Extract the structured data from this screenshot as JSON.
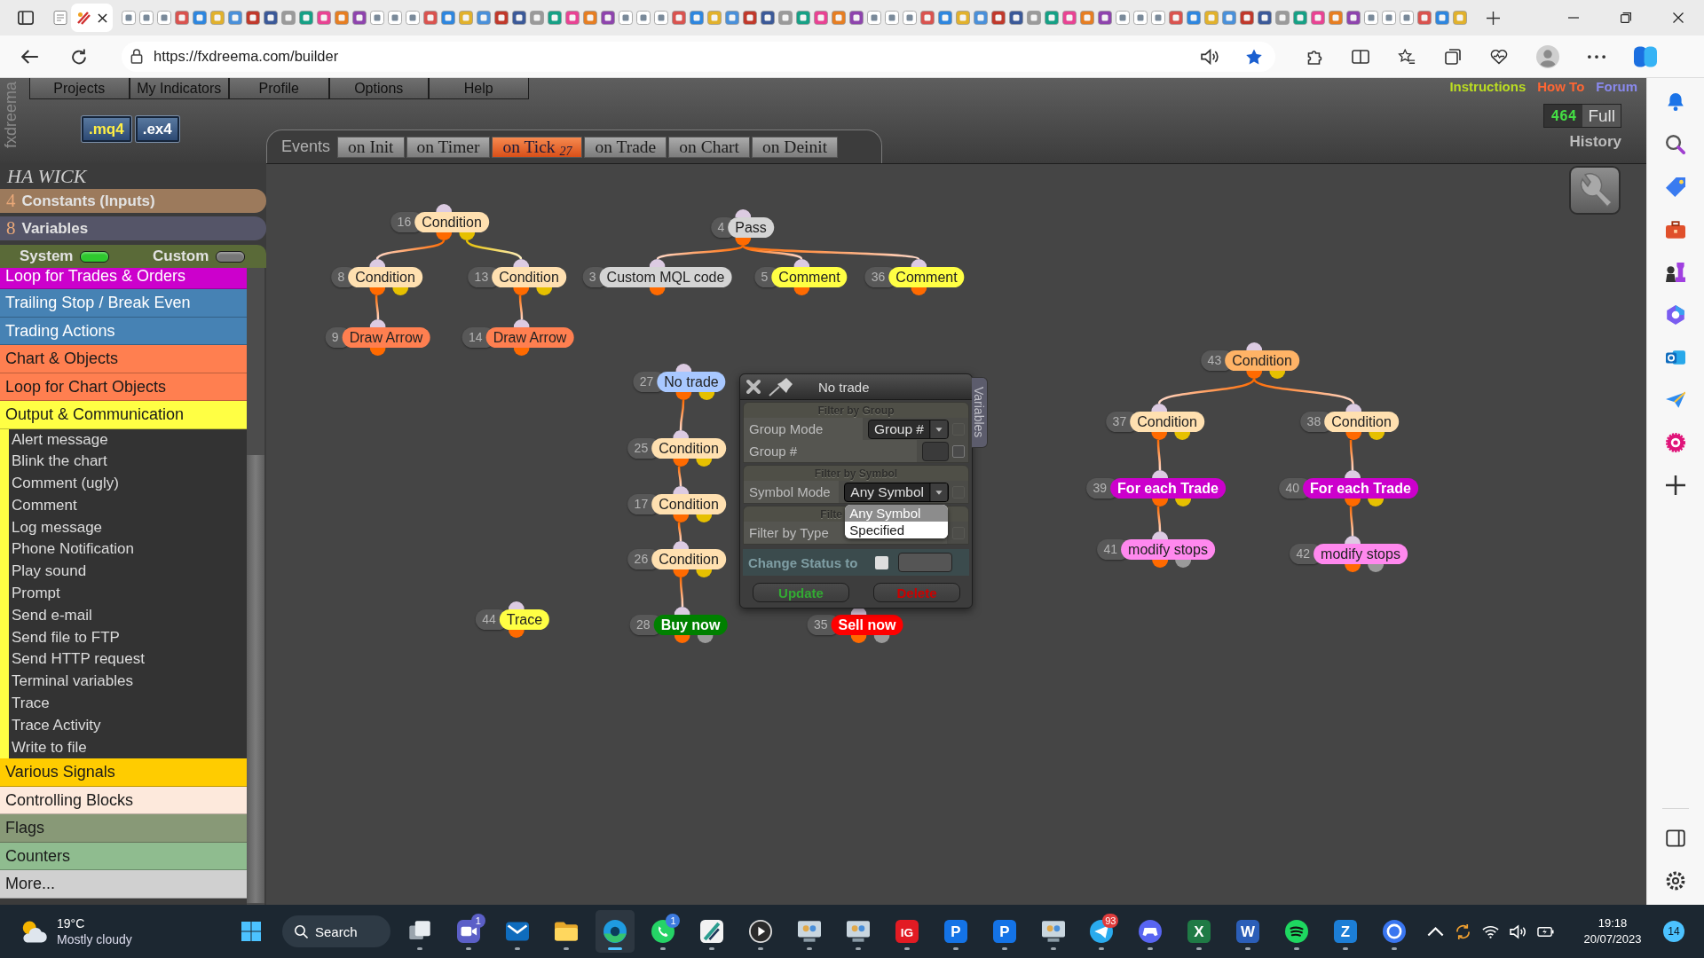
{
  "browser": {
    "url": "https://fxdreema.com/builder"
  },
  "app": {
    "logo": "fxdreema",
    "menu": [
      "Projects",
      "My Indicators",
      "Profile",
      "Options",
      "Help"
    ],
    "file_buttons": [
      {
        "label": ".mq4",
        "kind": "mq4"
      },
      {
        "label": ".ex4",
        "kind": "ex4"
      }
    ],
    "links": [
      {
        "label": "Instructions",
        "color": "#bbdd22"
      },
      {
        "label": "How To",
        "color": "#ff6633"
      },
      {
        "label": "Forum",
        "color": "#8a8aee"
      }
    ],
    "counter": {
      "value": "464",
      "label": "Full"
    },
    "history": "History",
    "events": {
      "label": "Events",
      "tabs": [
        {
          "label": "on Init",
          "selected": false
        },
        {
          "label": "on Timer",
          "selected": false
        },
        {
          "label": "on Tick",
          "count": "27",
          "selected": true
        },
        {
          "label": "on Trade",
          "selected": false
        },
        {
          "label": "on Chart",
          "selected": false
        },
        {
          "label": "on Deinit",
          "selected": false
        }
      ]
    },
    "project": {
      "name": "HA WICK",
      "constants": {
        "count": "4",
        "label": "Constants (Inputs)"
      },
      "variables": {
        "count": "8",
        "label": "Variables"
      },
      "toggles": [
        {
          "label": "System",
          "on": true
        },
        {
          "label": "Custom",
          "on": false
        }
      ]
    },
    "categories": [
      {
        "label": "Loop for Trades & Orders",
        "color": "#cc00cc"
      },
      {
        "label": "Trailing Stop / Break Even",
        "color": "#4682b4"
      },
      {
        "label": "Trading Actions",
        "color": "#4682b4"
      },
      {
        "label": "Chart & Objects",
        "color": "#ff7f50"
      },
      {
        "label": "Loop for Chart Objects",
        "color": "#ff7f50"
      },
      {
        "label": "Output & Communication",
        "color": "#ffff44",
        "children": [
          {
            "label": "Alert message"
          },
          {
            "label": "Blink the chart"
          },
          {
            "label": "Comment (ugly)"
          },
          {
            "label": "Comment"
          },
          {
            "label": "Log message"
          },
          {
            "label": "Phone Notification"
          },
          {
            "label": "Play sound"
          },
          {
            "label": "Prompt"
          },
          {
            "label": "Send e-mail"
          },
          {
            "label": "Send file to FTP"
          },
          {
            "label": "Send HTTP request"
          },
          {
            "label": "Terminal variables"
          },
          {
            "label": "Trace"
          },
          {
            "label": "Trace Activity"
          },
          {
            "label": "Write to file"
          }
        ]
      },
      {
        "label": "Various Signals",
        "color": "#ffcc00"
      },
      {
        "label": "Controlling Blocks",
        "color": "#fde9dc"
      },
      {
        "label": "Flags",
        "color": "#889977"
      },
      {
        "label": "Counters",
        "color": "#8fbc8f"
      },
      {
        "label": "More...",
        "color": "#d0d0d0"
      }
    ],
    "canvas": {
      "nodes": [
        {
          "number": "16",
          "label": "Condition",
          "kind": "condition",
          "color": "#ffe0b0",
          "children": [
            {
              "number": "8",
              "label": "Condition",
              "kind": "condition",
              "color": "#ffe0b0",
              "from_secondary": false,
              "children": [
                {
                  "number": "9",
                  "label": "Draw Arrow",
                  "kind": "action",
                  "color": "#ff7f50",
                  "from_secondary": false
                }
              ]
            },
            {
              "number": "13",
              "label": "Condition",
              "kind": "condition",
              "color": "#ffe0b0",
              "from_secondary": true,
              "children": [
                {
                  "number": "14",
                  "label": "Draw Arrow",
                  "kind": "action",
                  "color": "#ff7f50",
                  "from_secondary": false
                }
              ]
            }
          ]
        },
        {
          "number": "4",
          "label": "Pass",
          "kind": "action",
          "color": "#d4d4d4",
          "children": [
            {
              "number": "3",
              "label": "Custom MQL code",
              "kind": "action",
              "color": "#d4d4d4",
              "from_secondary": false
            },
            {
              "number": "5",
              "label": "Comment",
              "kind": "action",
              "color": "#ffff44",
              "from_secondary": false
            },
            {
              "number": "36",
              "label": "Comment",
              "kind": "action",
              "color": "#ffff44",
              "from_secondary": false
            }
          ]
        },
        {
          "number": "27",
          "label": "No trade",
          "kind": "condition",
          "color": "#a8c8ff",
          "children": [
            {
              "number": "25",
              "label": "Condition",
              "kind": "condition",
              "color": "#ffe0b0",
              "from_secondary": false,
              "children": [
                {
                  "number": "17",
                  "label": "Condition",
                  "kind": "condition",
                  "color": "#ffe0b0",
                  "from_secondary": false,
                  "children": [
                    {
                      "number": "26",
                      "label": "Condition",
                      "kind": "condition",
                      "color": "#ffe0b0",
                      "from_secondary": false,
                      "children": [
                        {
                          "number": "28",
                          "label": "Buy now",
                          "kind": "trade",
                          "color": "#008000",
                          "from_secondary": false
                        }
                      ]
                    }
                  ]
                }
              ]
            }
          ]
        },
        {
          "number": "44",
          "label": "Trace",
          "kind": "action",
          "color": "#ffff44"
        },
        {
          "number": "35",
          "label": "Sell now",
          "kind": "trade",
          "color": "#ff0000"
        },
        {
          "number": "43",
          "label": "Condition",
          "kind": "condition",
          "color": "#ffb366",
          "children": [
            {
              "number": "37",
              "label": "Condition",
              "kind": "condition",
              "color": "#ffe0b0",
              "from_secondary": false,
              "children": [
                {
                  "number": "39",
                  "label": "For each Trade",
                  "kind": "loop",
                  "color": "#cc00cc",
                  "from_secondary": false,
                  "children": [
                    {
                      "number": "41",
                      "label": "modify stops",
                      "kind": "trade",
                      "color": "#ff88ee",
                      "from_secondary": false
                    }
                  ]
                }
              ]
            },
            {
              "number": "38",
              "label": "Condition",
              "kind": "condition",
              "color": "#ffe0b0",
              "from_secondary": false,
              "children": [
                {
                  "number": "40",
                  "label": "For each Trade",
                  "kind": "loop",
                  "color": "#cc00cc",
                  "from_secondary": false,
                  "children": [
                    {
                      "number": "42",
                      "label": "modify stops",
                      "kind": "trade",
                      "color": "#ff88ee",
                      "from_secondary": false
                    }
                  ]
                }
              ]
            }
          ]
        }
      ]
    },
    "dialog": {
      "title": "No trade",
      "side_tab": "Variables",
      "sections": [
        {
          "header": "Filter by Group",
          "rows": [
            {
              "label": "Group Mode",
              "kind": "select",
              "value": "Group #",
              "open": false,
              "checkbox": {
                "checked": false,
                "disabled": true
              }
            },
            {
              "label": "Group #",
              "kind": "input",
              "checkbox": {
                "checked": false,
                "disabled": false
              }
            }
          ]
        },
        {
          "header": "Filter by Symbol",
          "rows": [
            {
              "label": "Symbol Mode",
              "kind": "select",
              "value": "Any Symbol",
              "open": true,
              "options": [
                {
                  "label": "Any Symbol",
                  "selected": true
                },
                {
                  "label": "Specified",
                  "selected": false
                }
              ],
              "checkbox": {
                "checked": false,
                "disabled": true
              }
            }
          ]
        },
        {
          "header": "Filte",
          "rows": [
            {
              "label": "Filter by Type",
              "checkbox": {
                "checked": false,
                "disabled": true
              }
            }
          ]
        }
      ],
      "status": {
        "label": "Change Status to",
        "checked": false
      },
      "buttons": [
        {
          "label": "Update",
          "kind": "update"
        },
        {
          "label": "Delete",
          "kind": "delete"
        }
      ]
    }
  },
  "taskbar": {
    "weather": {
      "temperature": "19°C",
      "condition": "Mostly cloudy"
    },
    "search": "Search",
    "apps": [
      {
        "kind": "task-view",
        "active": false
      },
      {
        "kind": "video-chat",
        "active": false,
        "badge": {
          "text": "1",
          "color": "#5b5fc7"
        }
      },
      {
        "kind": "mail",
        "active": false
      },
      {
        "kind": "folder",
        "active": false
      },
      {
        "kind": "browser",
        "active": true
      },
      {
        "kind": "phone-chat",
        "active": false,
        "badge": {
          "text": "1",
          "color": "#3d7be0"
        }
      },
      {
        "kind": "slash",
        "active": false
      },
      {
        "kind": "play",
        "active": false
      },
      {
        "kind": "people",
        "active": false
      },
      {
        "kind": "people",
        "active": false
      },
      {
        "kind": "letter",
        "glyph": "IG",
        "color": "#e21b23",
        "active": false
      },
      {
        "kind": "letter",
        "glyph": "P",
        "color": "#1473e6",
        "active": false
      },
      {
        "kind": "letter",
        "glyph": "P",
        "color": "#1473e6",
        "active": false
      },
      {
        "kind": "people",
        "active": false
      },
      {
        "kind": "paper-plane",
        "active": false,
        "badge": {
          "text": "93",
          "color": "#e03c3c"
        }
      },
      {
        "kind": "controller",
        "active": false
      },
      {
        "kind": "letter",
        "glyph": "X",
        "color": "#1f7a45",
        "active": false
      },
      {
        "kind": "letter",
        "glyph": "W",
        "color": "#2b5eb8",
        "active": false
      },
      {
        "kind": "music",
        "active": false
      },
      {
        "kind": "letter",
        "glyph": "Z",
        "color": "#1c7ed6",
        "active": false
      },
      {
        "kind": "chat-ring",
        "active": false
      }
    ],
    "clock": {
      "time": "19:18",
      "date": "20/07/2023"
    },
    "notifications": "14"
  }
}
